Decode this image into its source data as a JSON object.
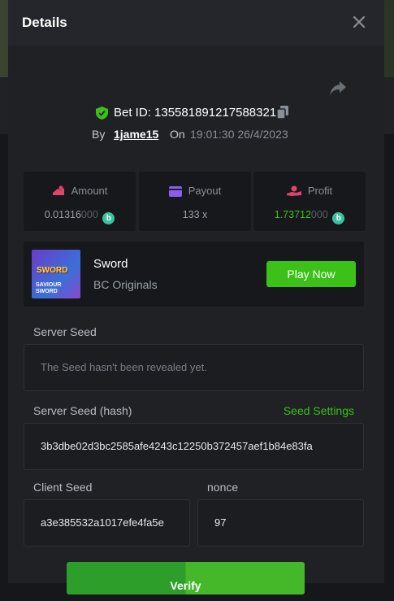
{
  "header": {
    "title": "Details"
  },
  "bet": {
    "id_label": "Bet ID: 135581891217588321",
    "by_label": "By",
    "user": "1jame15",
    "on_label": "On",
    "time": "19:01:30 26/4/2023"
  },
  "stats": {
    "amount": {
      "label": "Amount",
      "value_main": "0.01316",
      "value_dim": "000"
    },
    "payout": {
      "label": "Payout",
      "value": "133 x"
    },
    "profit": {
      "label": "Profit",
      "value_main": "1.73712",
      "value_dim": "000"
    },
    "coin_symbol": "b"
  },
  "game": {
    "thumb_title": "SWORD",
    "thumb_sub": "SAVIOUR SWORD",
    "name": "Sword",
    "provider": "BC Originals",
    "play_label": "Play Now"
  },
  "server_seed": {
    "label": "Server Seed",
    "value": "The Seed hasn't been revealed yet."
  },
  "server_seed_hash": {
    "label": "Server Seed (hash)",
    "settings_label": "Seed Settings",
    "value": "3b3dbe02d3bc2585afe4243c12250b372457aef1b84e83fa"
  },
  "client_seed": {
    "label": "Client Seed",
    "value": "a3e385532a1017efe4fa5e"
  },
  "nonce": {
    "label": "nonce",
    "value": "97"
  },
  "verify": {
    "label": "Verify"
  },
  "colors": {
    "accent": "#3bc117",
    "background": "#1f2125",
    "field": "#1b1d21"
  }
}
